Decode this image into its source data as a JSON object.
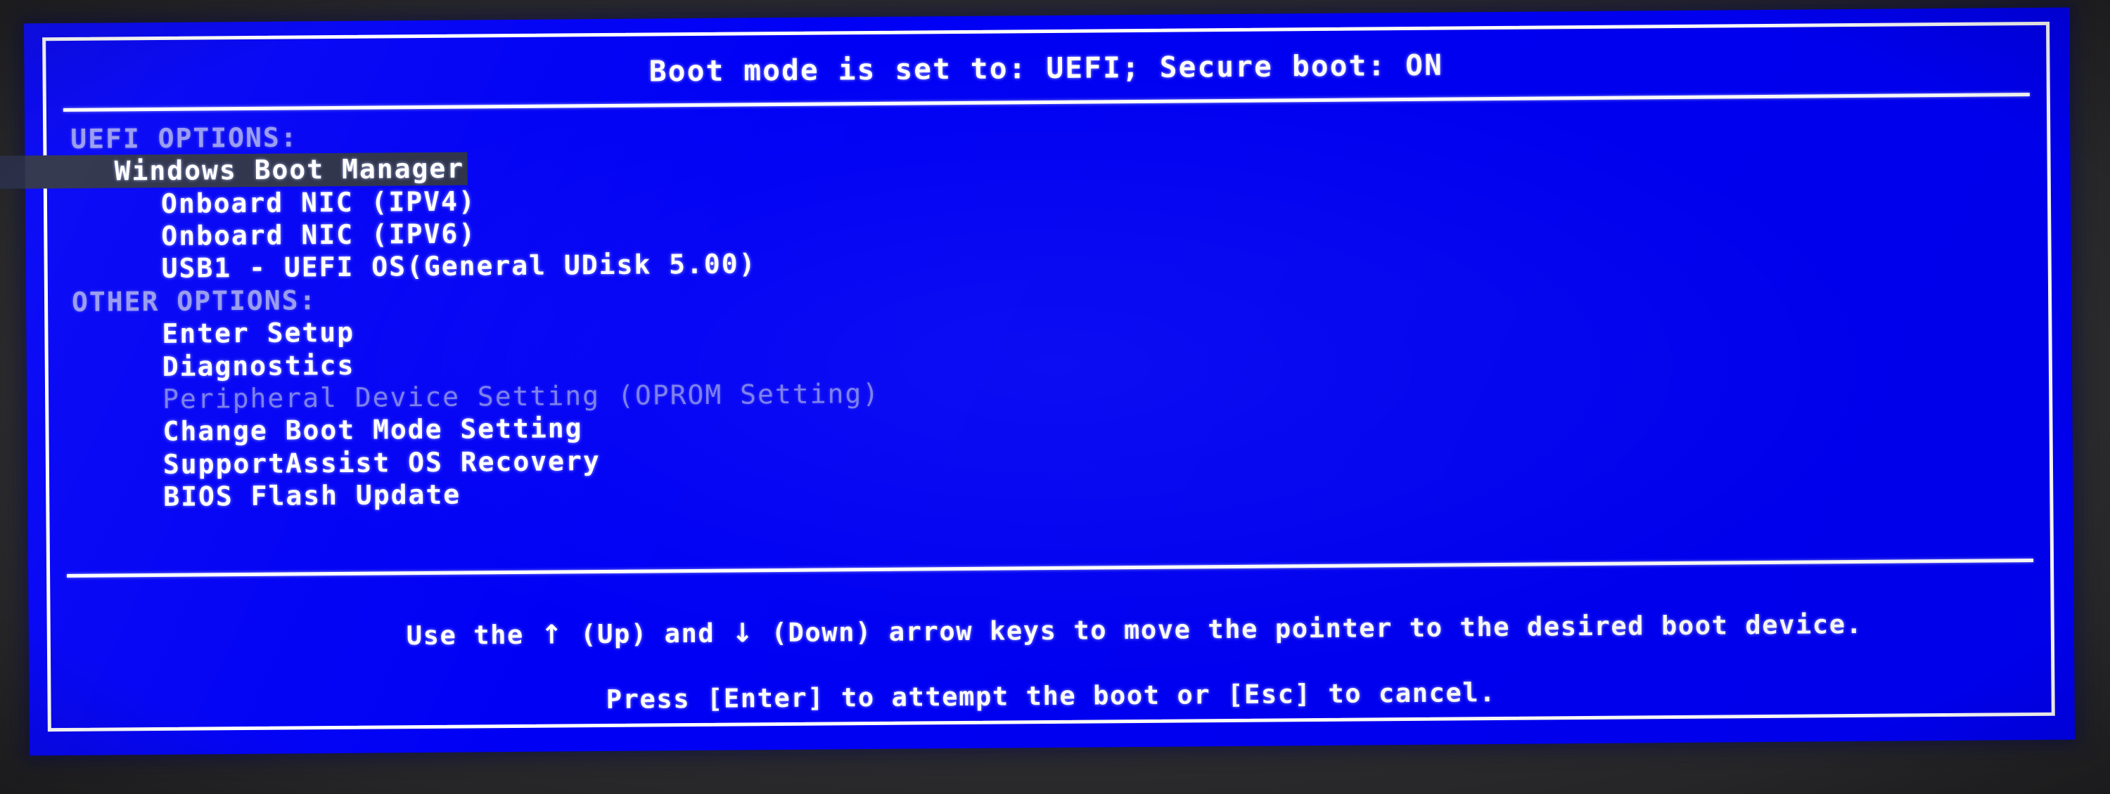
{
  "screen": {
    "background_color": "#0000f5",
    "text_color": "#ffffff",
    "highlight_color": "#2b3048",
    "dim_color": "#b9bcf0"
  },
  "header": {
    "title": "Boot mode is set to: UEFI; Secure boot: ON"
  },
  "sections": [
    {
      "header": "UEFI OPTIONS:",
      "items": [
        {
          "label": "Windows Boot Manager",
          "selected": true,
          "disabled": false
        },
        {
          "label": "Onboard NIC (IPV4)",
          "selected": false,
          "disabled": false
        },
        {
          "label": "Onboard NIC (IPV6)",
          "selected": false,
          "disabled": false
        },
        {
          "label": "USB1 - UEFI OS(General UDisk 5.00)",
          "selected": false,
          "disabled": false
        }
      ]
    },
    {
      "header": "OTHER OPTIONS:",
      "items": [
        {
          "label": "Enter Setup",
          "selected": false,
          "disabled": false
        },
        {
          "label": "Diagnostics",
          "selected": false,
          "disabled": false
        },
        {
          "label": "Peripheral Device Setting (OPROM Setting)",
          "selected": false,
          "disabled": true
        },
        {
          "label": "Change Boot Mode Setting",
          "selected": false,
          "disabled": false
        },
        {
          "label": "SupportAssist OS Recovery",
          "selected": false,
          "disabled": false
        },
        {
          "label": "BIOS Flash Update",
          "selected": false,
          "disabled": false
        }
      ]
    }
  ],
  "footer": {
    "line1_part1": "Use the ",
    "up_arrow": "↑",
    "line1_part2": " (Up) and ",
    "down_arrow": "↓",
    "line1_part3": " (Down) arrow keys to move the pointer to the desired boot device.",
    "line2": "Press [Enter] to attempt the boot or [Esc] to cancel."
  }
}
